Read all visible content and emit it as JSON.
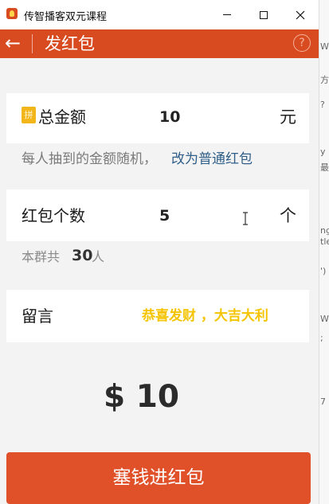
{
  "window": {
    "title": "传智播客双元课程"
  },
  "header": {
    "back_icon": "←",
    "title": "发红包",
    "help_icon": "?"
  },
  "amount": {
    "badge": "拼",
    "label": "总金额",
    "value": "10",
    "unit": "元"
  },
  "hint": {
    "text": "每人抽到的金额随机，",
    "link": "改为普通红包"
  },
  "count": {
    "label": "红包个数",
    "value": "5",
    "unit": "个"
  },
  "group": {
    "prefix": "本群共",
    "number": "30",
    "suffix": "人"
  },
  "message": {
    "label": "留言",
    "value": "恭喜发财 ，大吉大利"
  },
  "total": {
    "display": "$ 10"
  },
  "submit": {
    "label": "塞钱进红包"
  },
  "background_window": {
    "fragments": [
      "Wo",
      "方",
      "?",
      "y",
      "最",
      "ng",
      "tle",
      "')",
      "Wo",
      ";",
      "7"
    ]
  },
  "colors": {
    "header": "#d84b21",
    "button": "#e0512a",
    "link": "#2f5f88",
    "message": "#f5c400",
    "badge": "#f2b61b"
  }
}
